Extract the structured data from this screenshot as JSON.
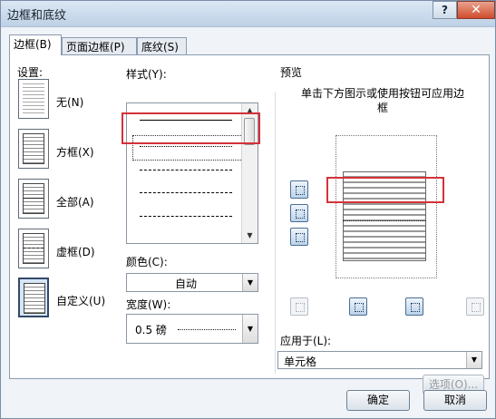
{
  "window": {
    "title": "边框和底纹",
    "help": "?",
    "close": "✕"
  },
  "tabs": [
    "边框(B)",
    "页面边框(P)",
    "底纹(S)"
  ],
  "settings": {
    "label": "设置:",
    "items": [
      "无(N)",
      "方框(X)",
      "全部(A)",
      "虚框(D)",
      "自定义(U)"
    ]
  },
  "style": {
    "label": "样式(Y):"
  },
  "color": {
    "label": "颜色(C):",
    "value": "自动"
  },
  "width": {
    "label": "宽度(W):",
    "value": "0.5 磅"
  },
  "preview": {
    "label": "预览",
    "hint": "单击下方图示或使用按钮可应用边框"
  },
  "apply": {
    "label": "应用于(L):",
    "value": "单元格",
    "options_button": "选项(O)..."
  },
  "buttons": {
    "ok": "确定",
    "cancel": "取消"
  },
  "accent": "#d3323a"
}
